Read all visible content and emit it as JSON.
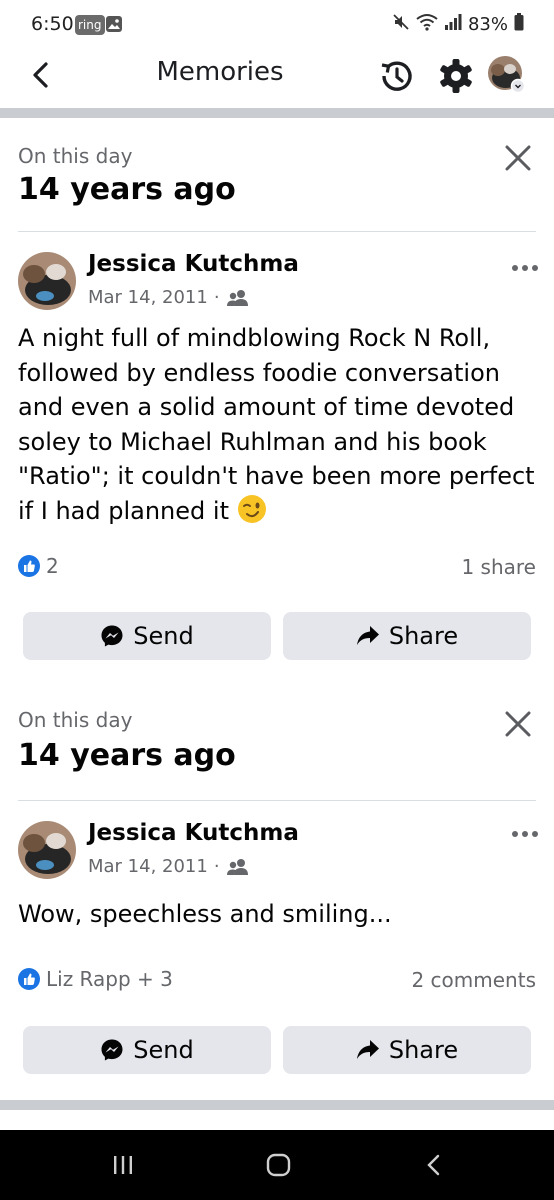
{
  "status_bar": {
    "time": "6:50",
    "ring_label": "ring",
    "battery": "83%"
  },
  "header": {
    "title": "Memories"
  },
  "memories": [
    {
      "label": "On this day",
      "years": "14 years ago",
      "author": "Jessica Kutchma",
      "date": "Mar 14, 2011",
      "text": "A night full of mindblowing Rock N Roll, followed by endless foodie conversation and even a solid amount of time devoted soley to Michael Ruhlman and his book \"Ratio\"; it couldn't have been more perfect if I had planned it",
      "reactions": "2",
      "engagement": "1 share",
      "send_label": "Send",
      "share_label": "Share"
    },
    {
      "label": "On this day",
      "years": "14 years ago",
      "author": "Jessica Kutchma",
      "date": "Mar 14, 2011",
      "text": "Wow, speechless and smiling...",
      "reactions": "Liz Rapp + 3",
      "engagement": "2 comments",
      "send_label": "Send",
      "share_label": "Share"
    }
  ],
  "colors": {
    "accent": "#1b74e4",
    "button_bg": "#e4e6eb",
    "secondary_text": "#65676b",
    "divider": "#c9ccd1"
  },
  "icons": {
    "privacy": "friends-icon",
    "reaction": "thumbs-up-icon",
    "send": "messenger-icon",
    "share": "share-arrow-icon"
  }
}
